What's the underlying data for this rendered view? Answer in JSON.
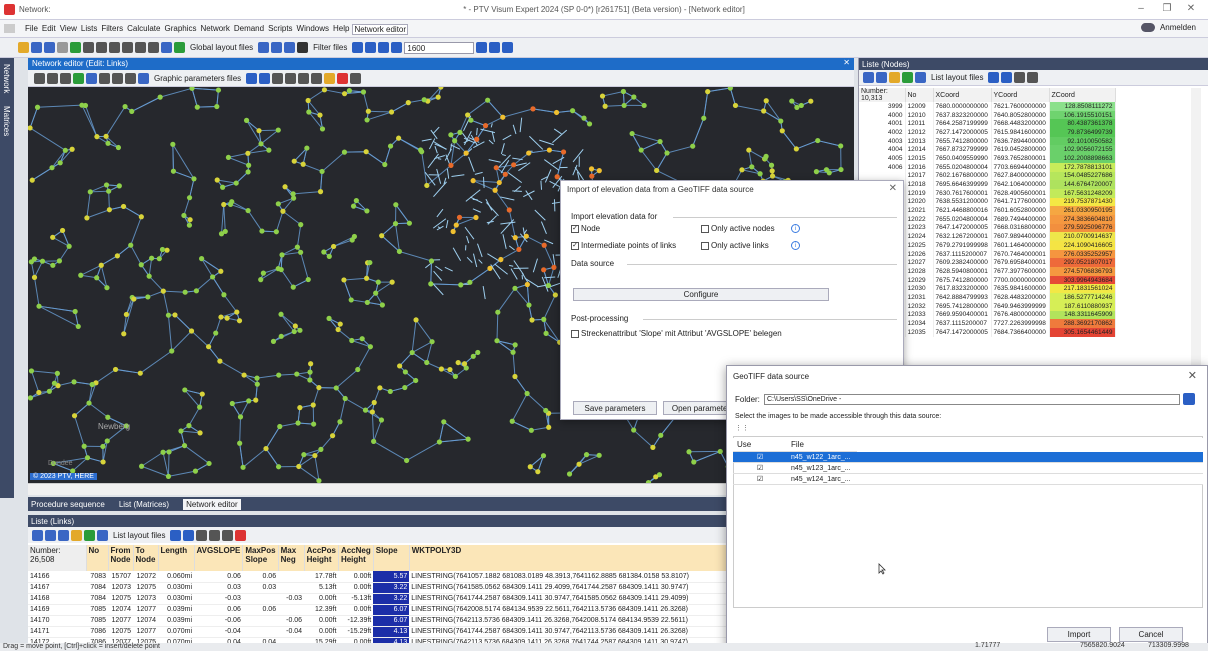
{
  "window": {
    "app_left": "Network:",
    "title": "* - PTV Visum Expert 2024 (SP 0-0*) [r261751] (Beta version) - [Network editor]"
  },
  "menu": [
    "File",
    "Edit",
    "View",
    "Lists",
    "Filters",
    "Calculate",
    "Graphics",
    "Network",
    "Demand",
    "Scripts",
    "Windows",
    "Help",
    "Network editor"
  ],
  "anmelden": "Anmelden",
  "toolbar": {
    "global_layout": "Global layout files",
    "filter_files": "Filter files",
    "zoom_value": "1600"
  },
  "leftstrip": {
    "network": "Network",
    "matrices": "Matrices"
  },
  "network_editor": {
    "title": "Network editor (Edit: Links)",
    "graphic_params": "Graphic parameters files",
    "copyright": "© 2023 PTV, HERE"
  },
  "bottom_tabs": [
    "Procedure sequence",
    "List (Matrices)",
    "Network editor"
  ],
  "map_labels": {
    "newberg": "Newberg",
    "dundee": "Dundee"
  },
  "links": {
    "title": "Liste (Links)",
    "list_layout": "List layout files",
    "number": "Number: 26,508",
    "columns": [
      "No",
      "From Node",
      "To Node",
      "Length",
      "AVGSLOPE",
      "MaxPos Slope",
      "Max Neg",
      "AccPos Height",
      "AccNeg Height",
      "Slope",
      "WKTPOLY3D"
    ],
    "rows": [
      [
        "14166",
        "7083",
        "15707",
        "12072",
        "0.060mi",
        "0.06",
        "0.06",
        "",
        "17.78ft",
        "0.00ft",
        "5.57",
        "LINESTRING(7641057.1882 681083.0189 48.3913,7641162.8885 681384.0158 53.8107)"
      ],
      [
        "14167",
        "7084",
        "12073",
        "12075",
        "0.030mi",
        "0.03",
        "0.03",
        "",
        "5.13ft",
        "0.00ft",
        "3.22",
        "LINESTRING(7641585.0562 684309.1411 29.4099,7641744.2587 684309.1411 30.9747)"
      ],
      [
        "14168",
        "7084",
        "12075",
        "12073",
        "0.030mi",
        "-0.03",
        "",
        "-0.03",
        "0.00ft",
        "-5.13ft",
        "3.22",
        "LINESTRING(7641744.2587 684309.1411 30.9747,7641585.0562 684309.1411 29.4099)"
      ],
      [
        "14169",
        "7085",
        "12074",
        "12077",
        "0.039mi",
        "0.06",
        "0.06",
        "",
        "12.39ft",
        "0.00ft",
        "6.07",
        "LINESTRING(7642008.5174 684134.9539 22.5611,7642113.5736 684309.1411 26.3268)"
      ],
      [
        "14170",
        "7085",
        "12077",
        "12074",
        "0.039mi",
        "-0.06",
        "",
        "-0.06",
        "0.00ft",
        "-12.39ft",
        "6.07",
        "LINESTRING(7642113.5736 684309.1411 26.3268,7642008.5174 684134.9539 22.5611)"
      ],
      [
        "14171",
        "7086",
        "12075",
        "12077",
        "0.070mi",
        "-0.04",
        "",
        "-0.04",
        "0.00ft",
        "-15.29ft",
        "4.13",
        "LINESTRING(7641744.2587 684309.1411 30.9747,7642113.5736 684309.1411 26.3268)"
      ],
      [
        "14172",
        "7086",
        "12077",
        "12075",
        "0.070mi",
        "0.04",
        "0.04",
        "",
        "15.29ft",
        "0.00ft",
        "4.13",
        "LINESTRING(7642113.5736 684309.1411 26.3268,7641744.2587 684309.1411 30.9747)"
      ]
    ]
  },
  "status": "Drag = move point, [Ctrl]+click = insert/delete point",
  "nodes": {
    "title": "Liste (Nodes)",
    "list_layout": "List layout files",
    "number": "Number: 10,313",
    "columns": [
      "No",
      "XCoord",
      "YCoord",
      "ZCoord"
    ],
    "rows": [
      [
        "3999",
        "12009",
        "7680.0000000000",
        "7621.7600000000",
        "128.8508111272",
        "#8be08b"
      ],
      [
        "4000",
        "12010",
        "7637.8323200000",
        "7640.8052800000",
        "106.1915510151",
        "#6fd36f"
      ],
      [
        "4001",
        "12011",
        "7664.2587199999",
        "7668.4483200000",
        "80.4387361378",
        "#55c655"
      ],
      [
        "4002",
        "12012",
        "7627.1472000005",
        "7615.9841600000",
        "79.8736499739",
        "#55c655"
      ],
      [
        "4003",
        "12013",
        "7655.7412800000",
        "7636.7894400000",
        "92.1010050582",
        "#62cc62"
      ],
      [
        "4004",
        "12014",
        "7667.8732799999",
        "7619.0452800000",
        "102.9056072155",
        "#6ad06a"
      ],
      [
        "4005",
        "12015",
        "7650.0409559990",
        "7693.7652800001",
        "102.2008898663",
        "#6ad06a"
      ],
      [
        "4006",
        "12016",
        "7655.0204800004",
        "7703.6694400000",
        "172.7878813101",
        "#c8ec5a"
      ],
      [
        "",
        "12017",
        "7602.1676800000",
        "7627.8400000000",
        "154.0485227686",
        "#b6e65c"
      ],
      [
        "",
        "12018",
        "7695.6646399999",
        "7642.1064000000",
        "144.6764720007",
        "#aee25e"
      ],
      [
        "",
        "12019",
        "7630.7617600001",
        "7628.4905600001",
        "167.5631248209",
        "#c2ea5a"
      ],
      [
        "",
        "12020",
        "7638.5531200000",
        "7641.7177600000",
        "219.7537871430",
        "#f4e844"
      ],
      [
        "",
        "12021",
        "7621.4468800016",
        "7601.6052800000",
        "261.0330950195",
        "#f5a742"
      ],
      [
        "",
        "12022",
        "7655.0204800004",
        "7689.7494400000",
        "274.3836604810",
        "#f59840"
      ],
      [
        "",
        "12023",
        "7647.1472000005",
        "7668.0316800000",
        "279.5925096776",
        "#f28f3e"
      ],
      [
        "",
        "12024",
        "7632.1267200001",
        "7607.9894400000",
        "210.0700914637",
        "#eee64a"
      ],
      [
        "",
        "12025",
        "7679.2791999998",
        "7601.1464000000",
        "224.1090416605",
        "#f4e444"
      ],
      [
        "",
        "12026",
        "7637.1115200007",
        "7670.7464000001",
        "276.0335252957",
        "#f5953f"
      ],
      [
        "",
        "12027",
        "7609.2382400000",
        "7679.6958400001",
        "292.0521807017",
        "#ee6a3a"
      ],
      [
        "",
        "12028",
        "7628.5940800001",
        "7677.3977600000",
        "274.5706836793",
        "#f59840"
      ],
      [
        "",
        "12029",
        "7675.7412800000",
        "7700.0000000000",
        "303.9964943684",
        "#e64a36"
      ],
      [
        "",
        "12030",
        "7617.8323200000",
        "7635.9841600000",
        "217.1831561024",
        "#f2e846"
      ],
      [
        "",
        "12031",
        "7642.8884799993",
        "7628.4483200000",
        "186.5277714246",
        "#d6ee56"
      ],
      [
        "",
        "12032",
        "7695.7412800000",
        "7649.9463999999",
        "187.6110880937",
        "#d6ee56"
      ],
      [
        "",
        "12033",
        "7669.9590400001",
        "7676.4800000000",
        "148.3311645909",
        "#b2e45c"
      ],
      [
        "",
        "12034",
        "7637.1115200007",
        "7727.2263999998",
        "288.3692170862",
        "#ef7a3c"
      ],
      [
        "",
        "12035",
        "7647.1472000005",
        "7684.7366400000",
        "305.1654461449",
        "#e44434"
      ]
    ]
  },
  "elev_dialog": {
    "title": "Import of elevation data from a GeoTIFF data source",
    "import_for": "Import elevation data for",
    "node": "Node",
    "only_active_nodes": "Only active nodes",
    "intermediate": "Intermediate points of links",
    "only_active_links": "Only active links",
    "data_source": "Data source",
    "configure": "Configure",
    "post": "Post-processing",
    "slope_attr": "Streckenattribut 'Slope' mit Attribut 'AVGSLOPE' belegen",
    "save": "Save parameters",
    "open": "Open parameters"
  },
  "geotiff": {
    "title": "GeoTIFF data source",
    "folder_label": "Folder:",
    "folder": "C:\\Users\\SS\\OneDrive -",
    "select": "Select the images to be made accessible through this data source:",
    "col_use": "Use",
    "col_file": "File",
    "files": [
      "n45_w122_1arc_...",
      "n45_w123_1arc_...",
      "n45_w124_1arc_..."
    ],
    "import": "Import",
    "cancel": "Cancel"
  },
  "bottom_right": {
    "v1": "1.71777",
    "v2": "7565820.9024",
    "v3": "713309.9998"
  }
}
